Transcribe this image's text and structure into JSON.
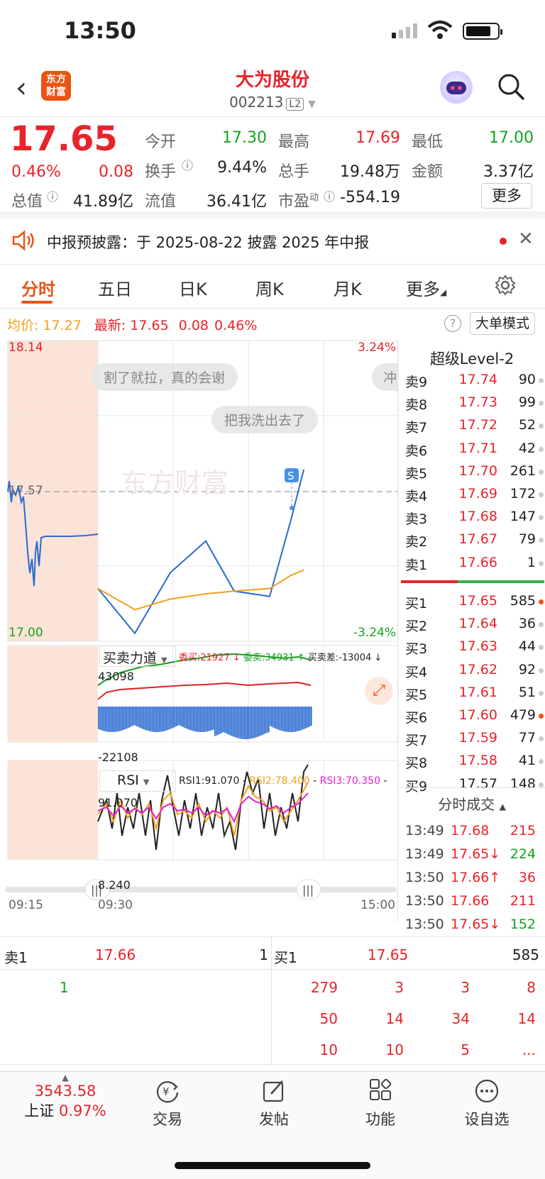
{
  "status_bar": {
    "time": "13:50"
  },
  "header": {
    "name": "大为股份",
    "code": "002213",
    "level": "L2",
    "logo_line1": "东方",
    "logo_line2": "财富"
  },
  "quote": {
    "price": "17.65",
    "change_pct": "0.46%",
    "change": "0.08",
    "open_label": "今开",
    "open": "17.30",
    "high_label": "最高",
    "high": "17.69",
    "low_label": "最低",
    "low": "17.00",
    "turnover_label": "换手",
    "turnover": "9.44%",
    "volume_label": "总手",
    "volume": "19.48万",
    "amount_label": "金额",
    "amount": "3.37亿",
    "mktcap_label": "总值",
    "mktcap": "41.89亿",
    "float_label": "流值",
    "float": "36.41亿",
    "pe_label": "市盈",
    "pe_sup": "动",
    "pe": "-554.19",
    "more_label": "更多"
  },
  "notice": {
    "label": "中报预披露：",
    "text": "于 2025-08-22 披露 2025 年中报"
  },
  "tabs": [
    "分时",
    "五日",
    "日K",
    "周K",
    "月K",
    "更多"
  ],
  "info_line": {
    "avg_label": "均价:",
    "avg": "17.27",
    "latest_label": "最新:",
    "latest": "17.65",
    "chg": "0.08",
    "pct": "0.46%",
    "big_order": "大单模式"
  },
  "chart": {
    "y_high": "18.14",
    "y_mid": "17.57",
    "y_low": "17.00",
    "pct_high": "3.24%",
    "pct_low": "-3.24%",
    "bubble1": "割了就拉，真的会谢",
    "bubble2": "把我洗出去了",
    "bubble3": "冲",
    "watermark": "东方财富",
    "marker": "S",
    "ind1_name": "买卖力道",
    "ind1_buy": "委买:21927 ↓",
    "ind1_sell": "委卖:34931 ↑",
    "ind1_diff": "买卖差:-13004 ↓",
    "ind1_max": "43098",
    "ind1_min": "-22108",
    "ind2_name": "RSI",
    "rsi1": "RSI1:91.070",
    "rsi2": "RSI2:78.400",
    "rsi3": "RSI3:70.350",
    "ind2_max": "91.070",
    "ind2_min": "8.240",
    "t_start": "09:15",
    "t_open": "09:30",
    "t_end": "15:00"
  },
  "chart_data": {
    "type": "line",
    "title": "",
    "x": [
      "09:30",
      "10:00",
      "10:30",
      "11:00",
      "11:30",
      "13:00",
      "13:30",
      "13:50"
    ],
    "series": [
      {
        "values": [
          17.2,
          17.03,
          17.26,
          17.38,
          17.19,
          17.17,
          17.46,
          17.65
        ]
      },
      {
        "values": [
          17.2,
          17.12,
          17.16,
          17.18,
          17.19,
          17.2,
          17.25,
          17.27
        ]
      }
    ],
    "ylim": [
      17.0,
      18.14
    ]
  },
  "level2": {
    "title": "超级Level-2",
    "asks": [
      {
        "label": "卖9",
        "price": "17.74",
        "vol": "90"
      },
      {
        "label": "卖8",
        "price": "17.73",
        "vol": "99"
      },
      {
        "label": "卖7",
        "price": "17.72",
        "vol": "52"
      },
      {
        "label": "卖6",
        "price": "17.71",
        "vol": "42"
      },
      {
        "label": "卖5",
        "price": "17.70",
        "vol": "261"
      },
      {
        "label": "卖4",
        "price": "17.69",
        "vol": "172"
      },
      {
        "label": "卖3",
        "price": "17.68",
        "vol": "147"
      },
      {
        "label": "卖2",
        "price": "17.67",
        "vol": "79"
      },
      {
        "label": "卖1",
        "price": "17.66",
        "vol": "1"
      }
    ],
    "bids": [
      {
        "label": "买1",
        "price": "17.65",
        "vol": "585"
      },
      {
        "label": "买2",
        "price": "17.64",
        "vol": "36"
      },
      {
        "label": "买3",
        "price": "17.63",
        "vol": "44"
      },
      {
        "label": "买4",
        "price": "17.62",
        "vol": "92"
      },
      {
        "label": "买5",
        "price": "17.61",
        "vol": "51"
      },
      {
        "label": "买6",
        "price": "17.60",
        "vol": "479"
      },
      {
        "label": "买7",
        "price": "17.59",
        "vol": "77"
      },
      {
        "label": "买8",
        "price": "17.58",
        "vol": "41"
      },
      {
        "label": "买9",
        "price": "17.57",
        "vol": "148"
      }
    ],
    "ticks_title": "分时成交",
    "ticks": [
      {
        "time": "13:49",
        "price": "17.68",
        "vol": "215"
      },
      {
        "time": "13:49",
        "price": "17.65↓",
        "vol": "224"
      },
      {
        "time": "13:50",
        "price": "17.66↑",
        "vol": "36"
      },
      {
        "time": "13:50",
        "price": "17.66",
        "vol": "211"
      },
      {
        "time": "13:50",
        "price": "17.65↓",
        "vol": "152"
      }
    ]
  },
  "queue": {
    "sell_label": "卖1",
    "sell_price": "17.66",
    "sell_count": "1",
    "buy_label": "买1",
    "buy_price": "17.65",
    "buy_count": "585",
    "sell_items": [
      "1"
    ],
    "buy_rows": [
      [
        "279",
        "3",
        "3",
        "8"
      ],
      [
        "50",
        "14",
        "34",
        "14"
      ],
      [
        "10",
        "10",
        "5",
        "..."
      ]
    ]
  },
  "nav": {
    "index_value": "3543.58",
    "index_name": "上证",
    "index_pct": "0.97%",
    "items": [
      "交易",
      "发帖",
      "功能",
      "设自选"
    ]
  }
}
